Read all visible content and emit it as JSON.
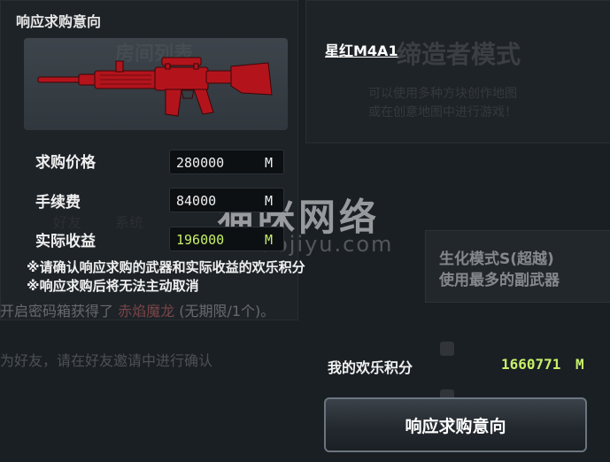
{
  "background": {
    "mode_title": "缔造者模式",
    "mode_desc_1": "可以使用多种方块创作地图",
    "mode_desc_2": "或在创意地图中进行游戏！",
    "room_list": "房间列表",
    "tab_friends": "好友",
    "tab_system": "系统",
    "bio_mode_1": "生化模式S(超越)",
    "bio_mode_2": "使用最多的副武器",
    "chat_prefix": "开启密码箱获得了",
    "chat_item": "赤焰魔龙",
    "chat_suffix": "(无期限/1个)。",
    "invite_text": "为好友，请在好友邀请中进行确认",
    "watermark": "猫咪网络",
    "watermark_url": "maojiyu.com"
  },
  "dialog": {
    "title": "响应求购意向",
    "weapon_name": "星红M4A1",
    "weapon_icon": "rifle-icon",
    "weapon_color": "#b3141c",
    "rows": [
      {
        "label": "求购价格",
        "value": "280000",
        "unit": "M"
      },
      {
        "label": "手续费",
        "value": "84000",
        "unit": "M"
      },
      {
        "label": "实际收益",
        "value": "196000",
        "unit": "M"
      }
    ],
    "notes": [
      "※请确认响应求购的武器和实际收益的欢乐积分",
      "※响应求购后将无法主动取消"
    ],
    "points_label": "我的欢乐积分",
    "points_value": "1660771",
    "points_unit": "M",
    "action_button": "响应求购意向",
    "accent_green": "#c7f06a"
  }
}
